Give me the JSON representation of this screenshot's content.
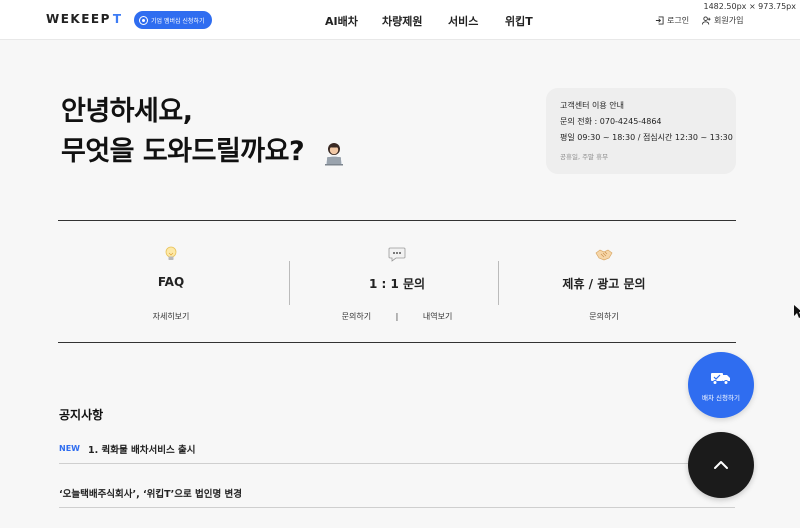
{
  "header": {
    "logo_text": "WEKEEP",
    "logo_mark": "T",
    "member_button": "기업 멤버십 신청하기",
    "nav": [
      "AI배차",
      "차량제원",
      "서비스",
      "위킵T"
    ],
    "login": "로그인",
    "signup": "회원가입",
    "dimension_readout": "1482.50px × 973.75px"
  },
  "hero": {
    "line1": "안녕하세요,",
    "line2": "무엇을 도와드릴까요?",
    "emoji_icon": "woman-at-laptop-icon"
  },
  "info": {
    "title": "고객센터 이용 안내",
    "phone": "문의 전화 : 070-4245-4864",
    "hours": "평일 09:30 ~ 18:30 / 점심시간 12:30 ~ 13:30",
    "closed": "공휴일, 주말 휴무"
  },
  "services": [
    {
      "icon": "lightbulb-icon",
      "name": "FAQ",
      "link1": "자세히보기"
    },
    {
      "icon": "speech-bubble-icon",
      "name": "1 : 1 문의",
      "link1": "문의하기",
      "separator": "|",
      "link2": "내역보기"
    },
    {
      "icon": "handshake-icon",
      "name": "제휴 / 광고 문의",
      "link1": "문의하기"
    }
  ],
  "notices": {
    "title": "공지사항",
    "items": [
      {
        "badge": "NEW",
        "text": "1. 퀵화물 배차서비스 출시"
      },
      {
        "badge": "",
        "text": "‘오늘택배주식회사’, ‘위킵T’으로 법인명 변경"
      }
    ]
  },
  "floating": {
    "dispatch_label": "배차 신청하기",
    "dispatch_icon": "truck-icon",
    "top_icon": "chevron-up-icon"
  },
  "colors": {
    "accent": "#2f6df0",
    "dark": "#1b1b1b"
  }
}
